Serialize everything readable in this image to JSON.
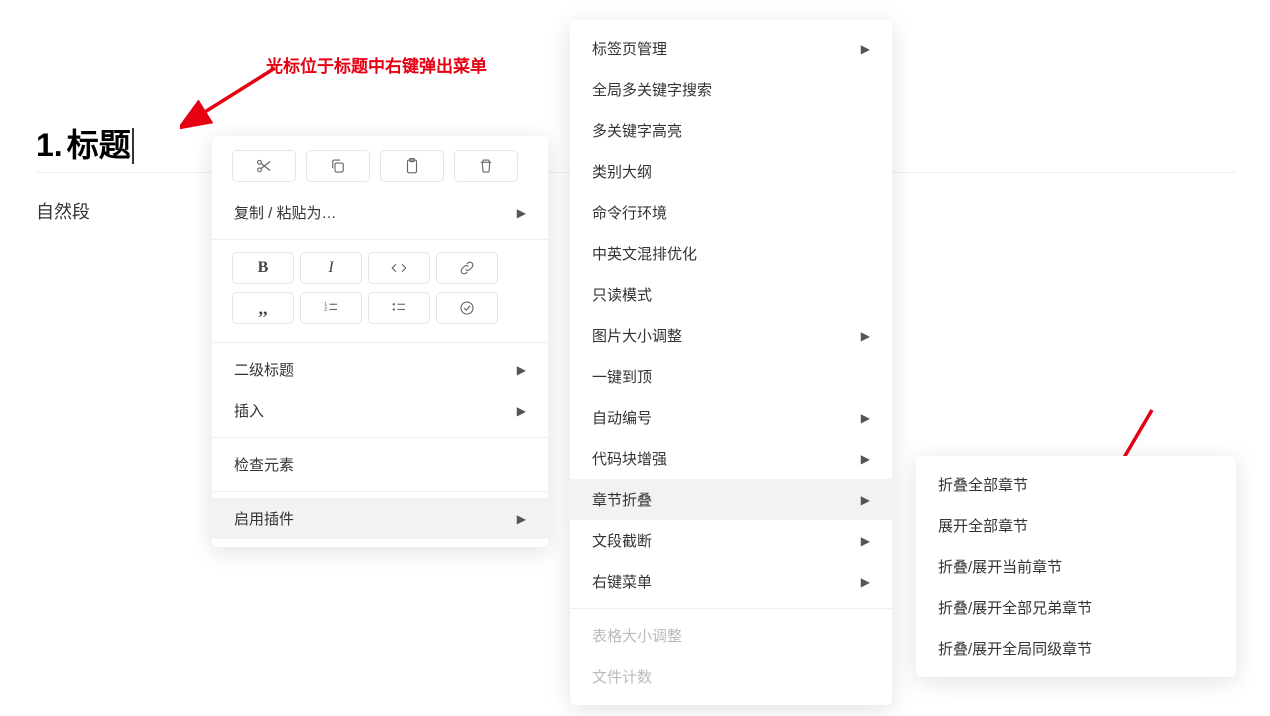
{
  "annotation_text": "光标位于标题中右键弹出菜单",
  "heading": {
    "number": "1.",
    "text": "标题"
  },
  "paragraph_text": "自然段",
  "menu1": {
    "copy_paste_as": "复制 / 粘贴为…",
    "heading_level": "二级标题",
    "insert": "插入",
    "inspect": "检查元素",
    "enable_plugin": "启用插件"
  },
  "menu2": {
    "items": [
      {
        "label": "标签页管理",
        "has_sub": true,
        "disabled": false
      },
      {
        "label": "全局多关键字搜索",
        "has_sub": false,
        "disabled": false
      },
      {
        "label": "多关键字高亮",
        "has_sub": false,
        "disabled": false
      },
      {
        "label": "类别大纲",
        "has_sub": false,
        "disabled": false
      },
      {
        "label": "命令行环境",
        "has_sub": false,
        "disabled": false
      },
      {
        "label": "中英文混排优化",
        "has_sub": false,
        "disabled": false
      },
      {
        "label": "只读模式",
        "has_sub": false,
        "disabled": false
      },
      {
        "label": "图片大小调整",
        "has_sub": true,
        "disabled": false
      },
      {
        "label": "一键到顶",
        "has_sub": false,
        "disabled": false
      },
      {
        "label": "自动编号",
        "has_sub": true,
        "disabled": false
      },
      {
        "label": "代码块增强",
        "has_sub": true,
        "disabled": false
      },
      {
        "label": "章节折叠",
        "has_sub": true,
        "disabled": false,
        "active": true
      },
      {
        "label": "文段截断",
        "has_sub": true,
        "disabled": false
      },
      {
        "label": "右键菜单",
        "has_sub": true,
        "disabled": false
      },
      {
        "divider": true
      },
      {
        "label": "表格大小调整",
        "has_sub": false,
        "disabled": true
      },
      {
        "label": "文件计数",
        "has_sub": false,
        "disabled": true
      }
    ]
  },
  "menu3": {
    "items": [
      "折叠全部章节",
      "展开全部章节",
      "折叠/展开当前章节",
      "折叠/展开全部兄弟章节",
      "折叠/展开全局同级章节"
    ]
  }
}
